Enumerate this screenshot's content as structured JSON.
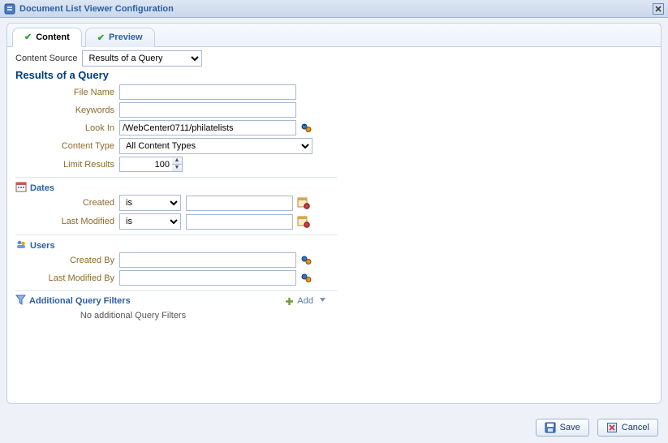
{
  "titlebar": {
    "title": "Document List Viewer Configuration"
  },
  "tabs": {
    "content": "Content",
    "preview": "Preview"
  },
  "contentSource": {
    "label": "Content Source",
    "value": "Results of a Query"
  },
  "sectionTitle": "Results of a Query",
  "fields": {
    "fileName": {
      "label": "File Name",
      "value": ""
    },
    "keywords": {
      "label": "Keywords",
      "value": ""
    },
    "lookIn": {
      "label": "Look In",
      "value": "/WebCenter0711/philatelists"
    },
    "contentType": {
      "label": "Content Type",
      "value": "All Content Types"
    },
    "limitResults": {
      "label": "Limit Results",
      "value": "100"
    }
  },
  "dates": {
    "header": "Dates",
    "created": {
      "label": "Created",
      "op": "is",
      "value": ""
    },
    "lastModified": {
      "label": "Last Modified",
      "op": "is",
      "value": ""
    }
  },
  "users": {
    "header": "Users",
    "createdBy": {
      "label": "Created By",
      "value": ""
    },
    "lastModifiedBy": {
      "label": "Last Modified By",
      "value": ""
    }
  },
  "addl": {
    "header": "Additional Query Filters",
    "addLabel": "Add",
    "empty": "No additional Query Filters"
  },
  "buttons": {
    "save": "Save",
    "cancel": "Cancel"
  }
}
